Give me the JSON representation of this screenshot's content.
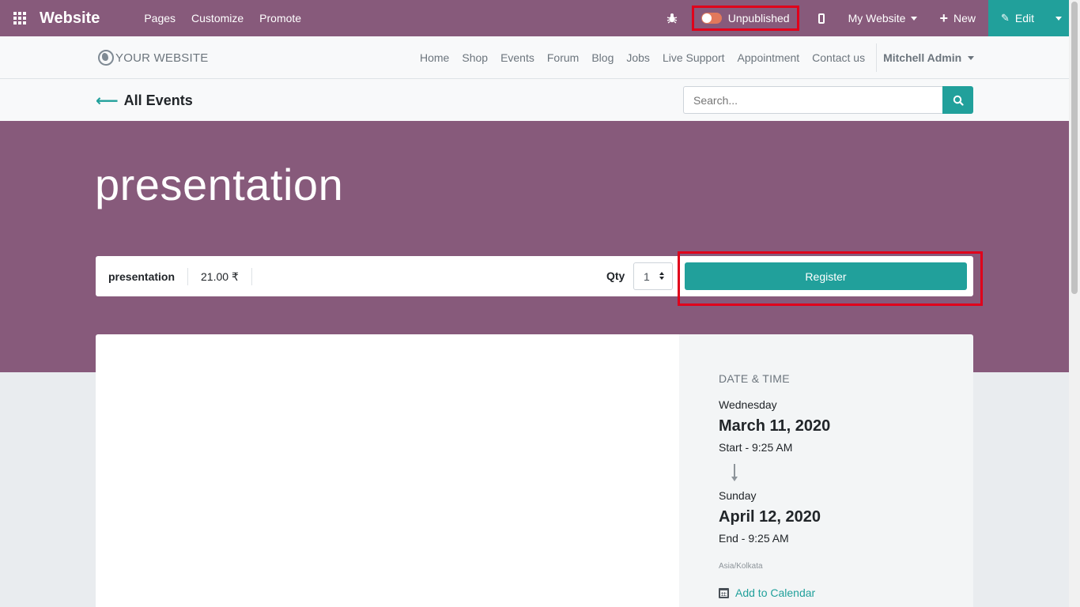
{
  "topbar": {
    "brand": "Website",
    "menu": [
      "Pages",
      "Customize",
      "Promote"
    ],
    "publish_label": "Unpublished",
    "my_website": "My Website",
    "new_label": "New",
    "edit_label": "Edit"
  },
  "site_header": {
    "logo_text": "YOUR WEBSITE",
    "nav": [
      "Home",
      "Shop",
      "Events",
      "Forum",
      "Blog",
      "Jobs",
      "Live Support",
      "Appointment",
      "Contact us"
    ],
    "user": "Mitchell Admin"
  },
  "events_bar": {
    "back_label": "All Events",
    "search_placeholder": "Search..."
  },
  "event": {
    "title": "presentation",
    "ticket": {
      "name": "presentation",
      "price": "21.00 ₹",
      "qty_label": "Qty",
      "qty_value": "1",
      "register_label": "Register"
    },
    "datetime": {
      "heading": "DATE & TIME",
      "start_day": "Wednesday",
      "start_date": "March 11, 2020",
      "start_time": "Start - 9:25 AM",
      "end_day": "Sunday",
      "end_date": "April 12, 2020",
      "end_time": "End - 9:25 AM",
      "timezone": "Asia/Kolkata",
      "add_to_calendar": "Add to Calendar"
    }
  },
  "colors": {
    "brand_purple": "#875a7b",
    "accent_teal": "#21a09b",
    "highlight_red": "#e0001b"
  }
}
